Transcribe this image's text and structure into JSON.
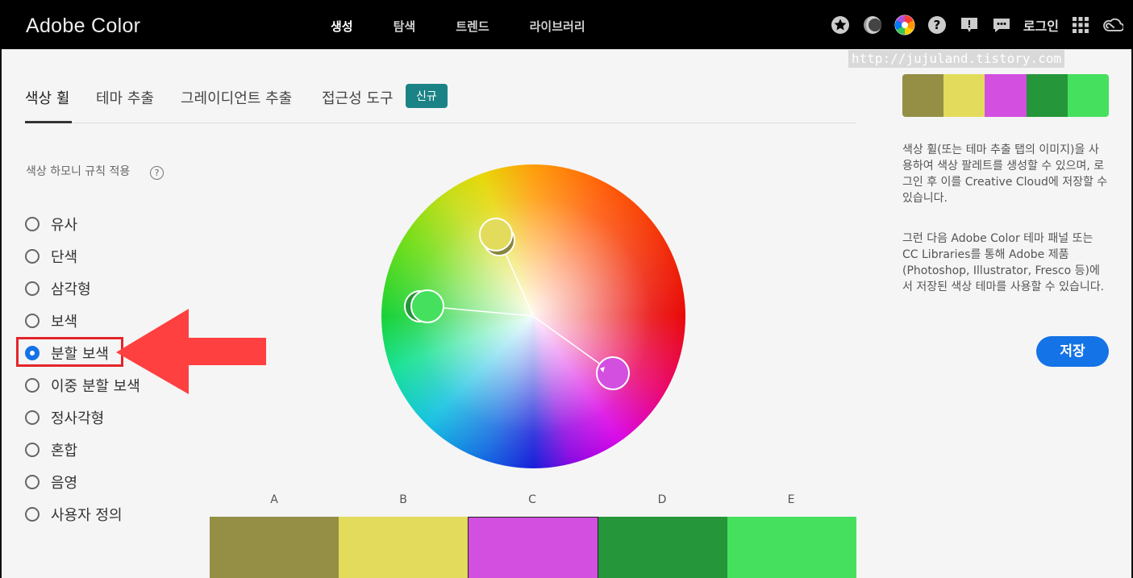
{
  "header": {
    "logo": "Adobe Color",
    "nav": [
      {
        "label": "생성",
        "active": true
      },
      {
        "label": "탐색",
        "active": false
      },
      {
        "label": "트렌드",
        "active": false
      },
      {
        "label": "라이브러리",
        "active": false
      }
    ],
    "icons": [
      "star-icon",
      "moon-icon",
      "color-wheel-icon",
      "help-icon",
      "alert-icon",
      "chat-icon"
    ],
    "login": "로그인",
    "apps_icon": "grid-icon",
    "cc_icon": "creative-cloud-icon"
  },
  "watermark": "http://jujuland.tistory.com",
  "tabs": {
    "items": [
      "색상 휠",
      "테마 추출",
      "그레이디언트 추출",
      "접근성 도구"
    ],
    "active_index": 0,
    "badge": "신규"
  },
  "harmony": {
    "title": "색상 하모니 규칙 적용",
    "help": "?",
    "options": [
      "유사",
      "단색",
      "삼각형",
      "보색",
      "분할 보색",
      "이중 분할 보색",
      "정사각형",
      "혼합",
      "음영",
      "사용자 정의"
    ],
    "selected_index": 4
  },
  "swatches": {
    "labels": [
      "A",
      "B",
      "C",
      "D",
      "E"
    ],
    "colors": [
      "#948f45",
      "#e3db5c",
      "#d34fe0",
      "#259639",
      "#46e05f"
    ],
    "selected_index": 2
  },
  "sidebar": {
    "palette": [
      "#948f45",
      "#e3db5c",
      "#d34fe0",
      "#259639",
      "#46e05f"
    ],
    "desc1": "색상 휠(또는 테마 추출 탭의 이미지)을 사용하여 색상 팔레트를 생성할 수 있으며, 로그인 후 이를 Creative Cloud에 저장할 수 있습니다.",
    "desc2": "그런 다음 Adobe Color 테마 패널 또는 CC Libraries를 통해 Adobe 제품 (Photoshop, Illustrator, Fresco 등)에서 저장된 색상 테마를 사용할 수 있습니다.",
    "save": "저장"
  },
  "colors": {
    "accent": "#1473e6",
    "badge": "#1b8385",
    "highlight": "#e3262b",
    "arrow": "#ff4040"
  }
}
